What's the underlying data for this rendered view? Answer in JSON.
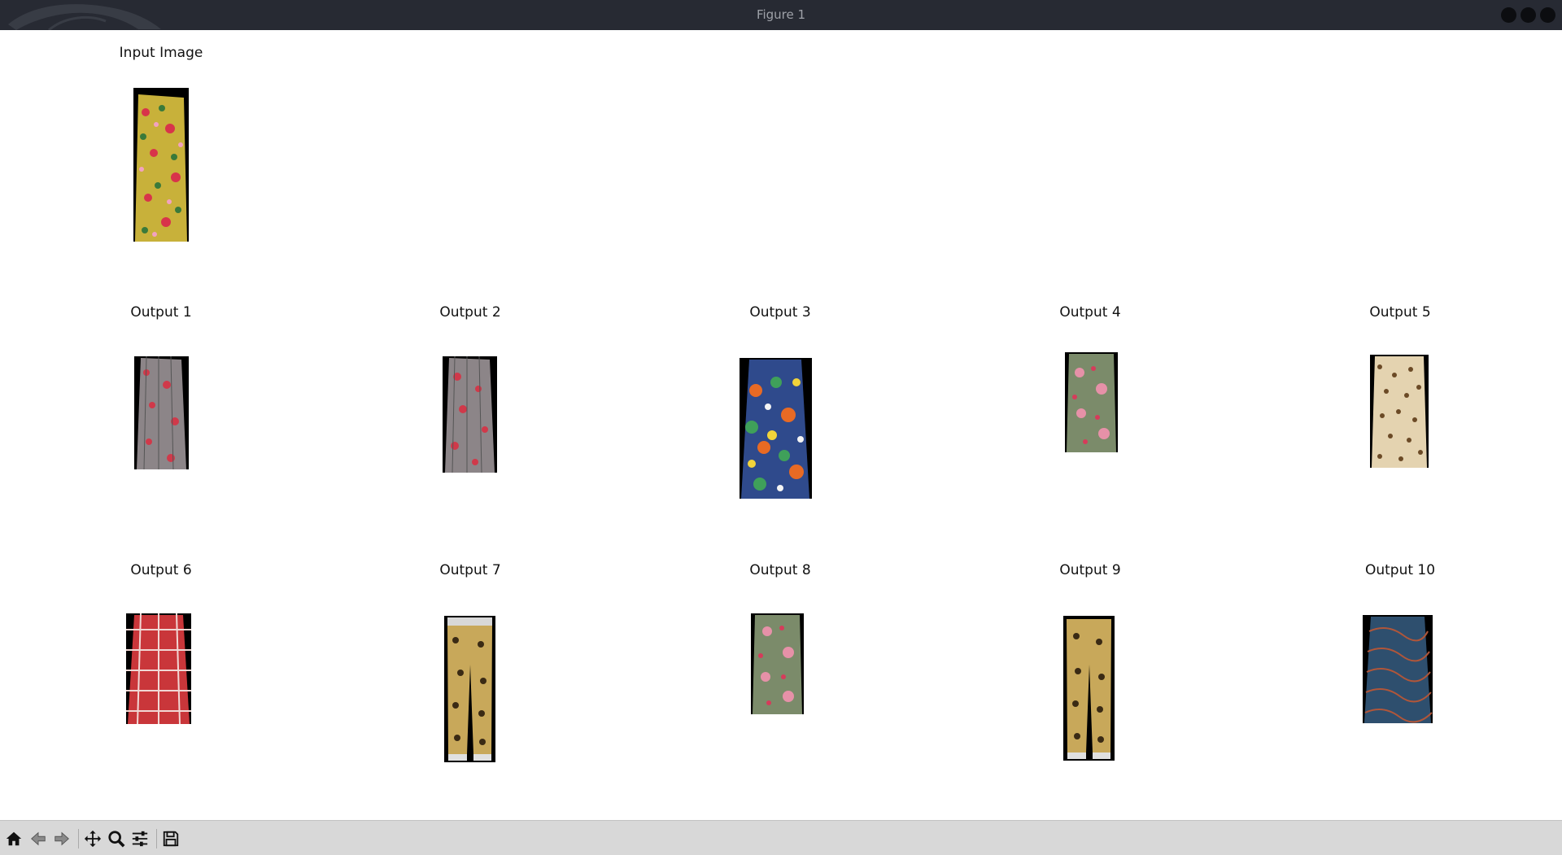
{
  "window": {
    "title": "Figure 1"
  },
  "figure": {
    "input": {
      "title": "Input Image",
      "image": "floral-maxi-skirt-multicolor"
    },
    "outputs": [
      {
        "title": "Output 1",
        "image": "red-grey-floral-pleated-skirt"
      },
      {
        "title": "Output 2",
        "image": "red-grey-floral-pleated-skirt"
      },
      {
        "title": "Output 3",
        "image": "tropical-print-maxi-skirt"
      },
      {
        "title": "Output 4",
        "image": "green-pink-floral-skirt"
      },
      {
        "title": "Output 5",
        "image": "leopard-print-pleated-skirt"
      },
      {
        "title": "Output 6",
        "image": "red-plaid-flared-skirt"
      },
      {
        "title": "Output 7",
        "image": "baroque-print-jogger-pants"
      },
      {
        "title": "Output 8",
        "image": "green-pink-floral-skirt"
      },
      {
        "title": "Output 9",
        "image": "baroque-print-jogger-pants"
      },
      {
        "title": "Output 10",
        "image": "blue-rust-print-midi-skirt"
      }
    ]
  },
  "toolbar": {
    "buttons": [
      {
        "name": "home-icon"
      },
      {
        "name": "back-arrow-icon"
      },
      {
        "name": "forward-arrow-icon"
      },
      {
        "name": "pan-move-icon"
      },
      {
        "name": "zoom-magnifier-icon"
      },
      {
        "name": "configure-subplots-icon"
      },
      {
        "name": "save-floppy-icon"
      }
    ]
  },
  "colors": {
    "titlebar_bg": "#272a33",
    "toolbar_bg": "#d8d8d8"
  }
}
